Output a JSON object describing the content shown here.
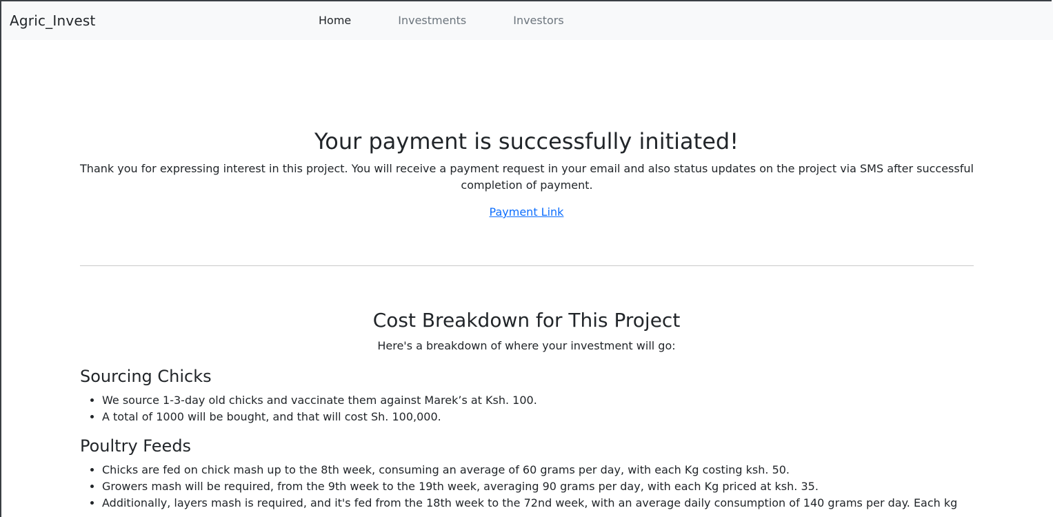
{
  "nav": {
    "brand": "Agric_Invest",
    "links": [
      "Home",
      "Investments",
      "Investors"
    ]
  },
  "hero": {
    "title": "Your payment is successfully initiated!",
    "text": "Thank you for expressing interest in this project. You will receive a payment request in your email and also status updates on the project via SMS after successful completion of payment.",
    "link": "Payment Link"
  },
  "cost": {
    "title": "Cost Breakdown for This Project",
    "subtitle": "Here's a breakdown of where your investment will go:",
    "sections": [
      {
        "heading": "Sourcing Chicks",
        "items": [
          "We source 1-3-day old chicks and vaccinate them against Marek’s at Ksh. 100.",
          "A total of 1000 will be bought, and that will cost Sh. 100,000."
        ]
      },
      {
        "heading": "Poultry Feeds",
        "items": [
          "Chicks are fed on chick mash up to the 8th week, consuming an average of 60 grams per day, with each Kg costing ksh. 50.",
          "Growers mash will be required, from the 9th week to the 19th week, averaging 90 grams per day, with each Kg priced at ksh. 35.",
          "Additionally, layers mash is required, and it's fed from the 18th week to the 72nd week, with an average daily consumption of 140 grams per day. Each kg"
        ]
      }
    ]
  }
}
